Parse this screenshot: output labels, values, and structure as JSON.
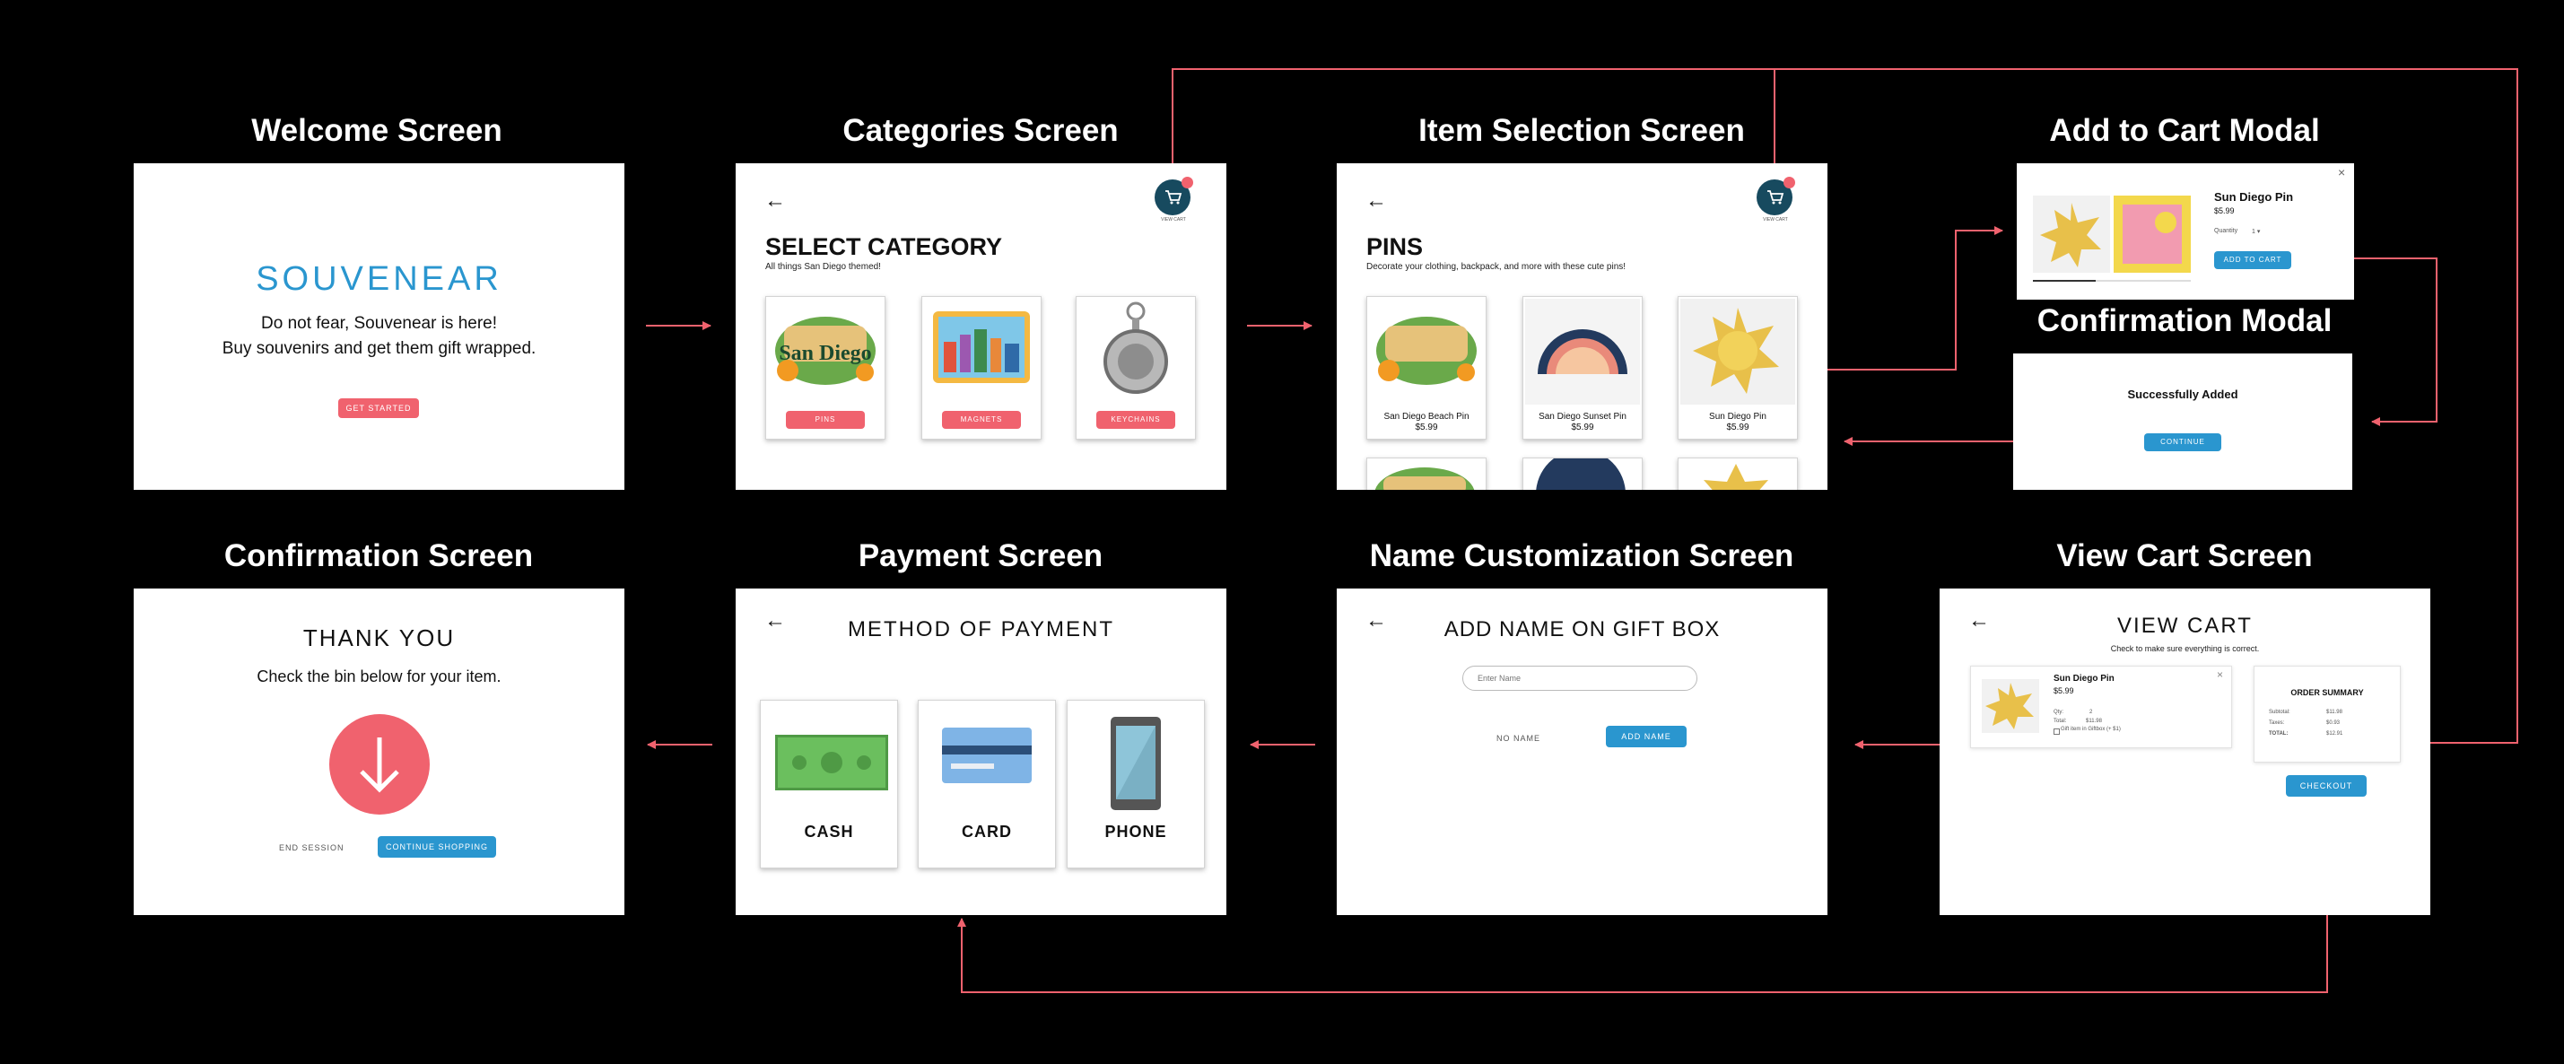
{
  "titles": {
    "welcome": "Welcome Screen",
    "categories": "Categories Screen",
    "item_selection": "Item Selection Screen",
    "add_to_cart": "Add to Cart Modal",
    "confirmation_modal": "Confirmation Modal",
    "confirmation": "Confirmation Screen",
    "payment": "Payment Screen",
    "name_custom": "Name Customization Screen",
    "view_cart": "View Cart Screen"
  },
  "welcome": {
    "logo": "SOUVENEAR",
    "line1": "Do not fear, Souvenear is here!",
    "line2": "Buy souvenirs and get them gift wrapped.",
    "button": "GET STARTED"
  },
  "categories": {
    "back": "←",
    "heading": "SELECT CATEGORY",
    "subheading": "All things San Diego themed!",
    "view_cart": "VIEW CART",
    "items": [
      {
        "label": "PINS",
        "image": "San Diego"
      },
      {
        "label": "MAGNETS",
        "image": ""
      },
      {
        "label": "KEYCHAINS",
        "image": ""
      }
    ]
  },
  "item_selection": {
    "back": "←",
    "heading": "PINS",
    "subheading": "Decorate your clothing, backpack, and more with these cute pins!",
    "view_cart": "VIEW CART",
    "items": [
      {
        "name": "San Diego Beach Pin",
        "price": "$5.99"
      },
      {
        "name": "San Diego Sunset Pin",
        "price": "$5.99"
      },
      {
        "name": "Sun Diego Pin",
        "price": "$5.99"
      }
    ]
  },
  "add_to_cart": {
    "close": "×",
    "name": "Sun Diego Pin",
    "price": "$5.99",
    "quantity_label": "Quantity",
    "quantity_value": "1 ▾",
    "button": "ADD TO CART"
  },
  "confirmation_modal": {
    "message": "Successfully Added",
    "button": "CONTINUE"
  },
  "confirmation": {
    "heading": "THANK YOU",
    "message": "Check the bin below for your item.",
    "end": "END SESSION",
    "continue": "CONTINUE SHOPPING"
  },
  "payment": {
    "back": "←",
    "heading": "METHOD OF PAYMENT",
    "options": [
      "CASH",
      "CARD",
      "PHONE"
    ]
  },
  "name_custom": {
    "back": "←",
    "heading": "ADD NAME ON GIFT BOX",
    "placeholder": "Enter Name",
    "no_name": "NO NAME",
    "add_name": "ADD NAME"
  },
  "view_cart": {
    "back": "←",
    "heading": "VIEW CART",
    "subheading": "Check to make sure everything is correct.",
    "item_name": "Sun Diego Pin",
    "item_price": "$5.99",
    "qty_label": "Qty:",
    "qty_value": "2",
    "total_label": "Total:",
    "total_value": "$11.98",
    "gift_option": "Gift item in Giftbox (+ $1)",
    "close": "×",
    "summary_title": "ORDER SUMMARY",
    "summary": [
      {
        "label": "Subtotal:",
        "value": "$11.98"
      },
      {
        "label": "Taxes:",
        "value": "$0.93"
      },
      {
        "label": "TOTAL:",
        "value": "$12.91"
      }
    ],
    "checkout": "CHECKOUT"
  },
  "colors": {
    "accent_pink": "#f0626e",
    "accent_blue": "#2a96cf",
    "cart_navy": "#174a5f",
    "arrow": "#f0626e",
    "background": "#000000"
  }
}
